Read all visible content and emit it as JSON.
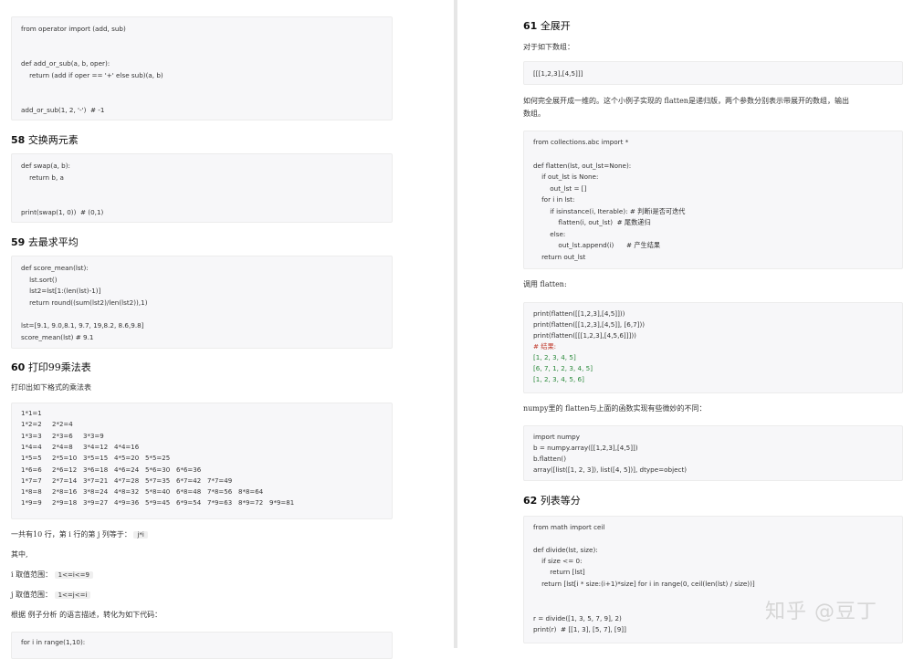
{
  "left": {
    "code1": [
      "from operator import (add, sub)",
      "",
      "",
      "def add_or_sub(a, b, oper):",
      "    return (add if oper == '+' else sub)(a, b)",
      "",
      "",
      "add_or_sub(1, 2, '-')  # -1"
    ],
    "h58_num": "58",
    "h58_text": "交换两元素",
    "code2": [
      "def swap(a, b):",
      "    return b, a",
      "",
      "",
      "print(swap(1, 0))  # (0,1)"
    ],
    "h59_num": "59",
    "h59_text": "去最求平均",
    "code3": [
      "def score_mean(lst):",
      "    lst.sort()",
      "    lst2=lst[1:(len(lst)-1)]",
      "    return round((sum(lst2)/len(lst2)),1)",
      "",
      "lst=[9.1, 9.0,8.1, 9.7, 19,8.2, 8.6,9.8]",
      "score_mean(lst) # 9.1"
    ],
    "h60_num": "60",
    "h60_text": "打印99乘法表",
    "p60": "打印出如下格式的乘法表",
    "table": [
      [
        "1*1=1"
      ],
      [
        "1*2=2",
        "2*2=4"
      ],
      [
        "1*3=3",
        "2*3=6",
        "3*3=9"
      ],
      [
        "1*4=4",
        "2*4=8",
        "3*4=12",
        "4*4=16"
      ],
      [
        "1*5=5",
        "2*5=10",
        "3*5=15",
        "4*5=20",
        "5*5=25"
      ],
      [
        "1*6=6",
        "2*6=12",
        "3*6=18",
        "4*6=24",
        "5*6=30",
        "6*6=36"
      ],
      [
        "1*7=7",
        "2*7=14",
        "3*7=21",
        "4*7=28",
        "5*7=35",
        "6*7=42",
        "7*7=49"
      ],
      [
        "1*8=8",
        "2*8=16",
        "3*8=24",
        "4*8=32",
        "5*8=40",
        "6*8=48",
        "7*8=56",
        "8*8=64"
      ],
      [
        "1*9=9",
        "2*9=18",
        "3*9=27",
        "4*9=36",
        "5*9=45",
        "6*9=54",
        "7*9=63",
        "8*9=72",
        "9*9=81"
      ]
    ],
    "p_total": "一共有10 行，第 i 行的第 j 列等于：",
    "p_total_code": "j*i",
    "p_other": "其中,",
    "p_i": "i 取值范围：",
    "p_i_code": "1<=i<=9",
    "p_j": "j 取值范围：",
    "p_j_code": "1<=j<=i",
    "p_convert": "根据 例子分析 的语言描述，转化为如下代码：",
    "code4": [
      "for i in range(1,10):"
    ]
  },
  "right": {
    "h61_num": "61",
    "h61_text": "全展开",
    "p61a": "对于如下数组：",
    "code_a": [
      "[[[1,2,3],[4,5]]]"
    ],
    "p61b": "如何完全展开成一维的。这个小例子实现的 flatten是递归版，两个参数分别表示带展开的数组，输出",
    "p61b2": "数组。",
    "code_b": [
      "from collections.abc import *",
      "",
      "def flatten(lst, out_lst=None):",
      "    if out_lst is None:",
      "        out_lst = []",
      "    for i in lst:",
      "        if isinstance(i, Iterable): # 判断i是否可迭代",
      "            flatten(i, out_lst)  # 尾数递归",
      "        else:",
      "            out_lst.append(i)      # 产生结果",
      "    return out_lst"
    ],
    "p_call": "调用 flatten:",
    "code_c": [
      "print(flatten([[1,2,3],[4,5]]))",
      "print(flatten([[1,2,3],[4,5]], [6,7]))",
      "print(flatten([[[1,2,3],[4,5,6]]]))",
      "# 结果:",
      "[1, 2, 3, 4, 5]",
      "[6, 7, 1, 2, 3, 4, 5]",
      "[1, 2, 3, 4, 5, 6]"
    ],
    "p_numpy": "numpy里的 flatten与上面的函数实现有些微妙的不同：",
    "code_d": [
      "import numpy",
      "b = numpy.array([[1,2,3],[4,5]])",
      "b.flatten()",
      "array([list([1, 2, 3]), list([4, 5])], dtype=object)"
    ],
    "h62_num": "62",
    "h62_text": "列表等分",
    "code_e": [
      "from math import ceil",
      "",
      "def divide(lst, size):",
      "    if size <= 0:",
      "        return [lst]",
      "    return [lst[i * size:(i+1)*size] for i in range(0, ceil(len(lst) / size))]",
      "",
      "",
      "r = divide([1, 3, 5, 7, 9], 2)",
      "print(r)  # [[1, 3], [5, 7], [9]]"
    ]
  },
  "watermark": "知乎 @豆丁"
}
